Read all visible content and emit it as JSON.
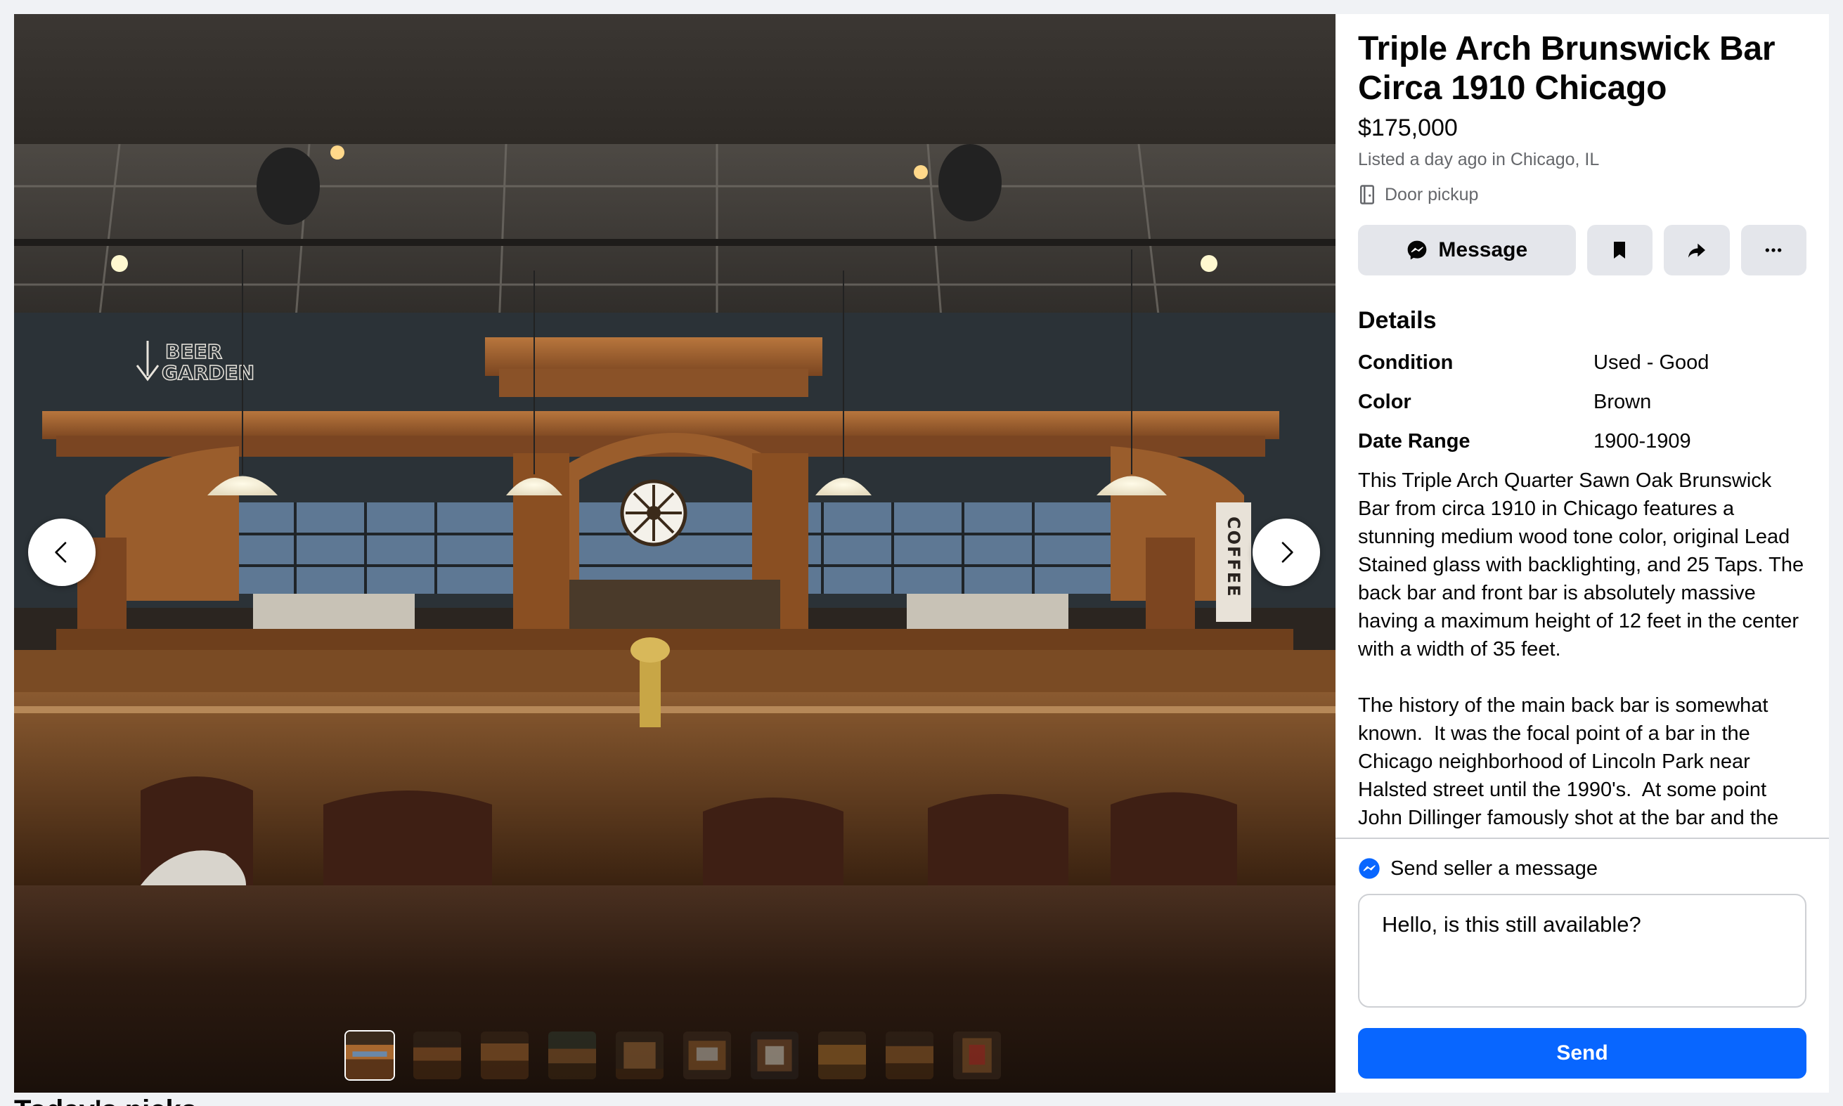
{
  "listing": {
    "title": "Triple Arch Brunswick Bar Circa 1910 Chicago",
    "price": "$175,000",
    "listed": "Listed a day ago in Chicago, IL",
    "pickup": "Door pickup"
  },
  "actions": {
    "message_label": "Message",
    "save_icon": "bookmark-icon",
    "share_icon": "share-icon",
    "more_icon": "more-icon"
  },
  "details": {
    "heading": "Details",
    "rows": [
      {
        "key": "Condition",
        "value": "Used - Good"
      },
      {
        "key": "Color",
        "value": "Brown"
      },
      {
        "key": "Date Range",
        "value": "1900-1909"
      }
    ],
    "description": "This Triple Arch Quarter Sawn Oak Brunswick Bar from circa 1910 in Chicago features a stunning medium wood tone color, original Lead Stained glass with backlighting, and 25 Taps. The back bar and front bar is absolutely massive having a maximum height of 12 feet in the center with a width of 35 feet.\n\nThe history of the main back bar is somewhat known.  It was the focal point of a bar in the Chicago neighborhood of Lincoln Park near Halsted street until the 1990's.  At some point John Dillinger famously shot at the bar and the"
  },
  "photo_sign": {
    "beer_garden_line1": "BEER",
    "beer_garden_line2": "GARDEN",
    "coffee": "COFFEE"
  },
  "send": {
    "header": "Send seller a message",
    "input_value": "Hello, is this still available?",
    "button_label": "Send"
  },
  "thumbnails": {
    "count": 10,
    "active_index": 0
  },
  "below_heading": "Today's picks",
  "colors": {
    "accent": "#0866ff",
    "page_bg": "#f0f2f5",
    "button_bg": "#e4e6eb",
    "secondary_text": "#65676b"
  }
}
